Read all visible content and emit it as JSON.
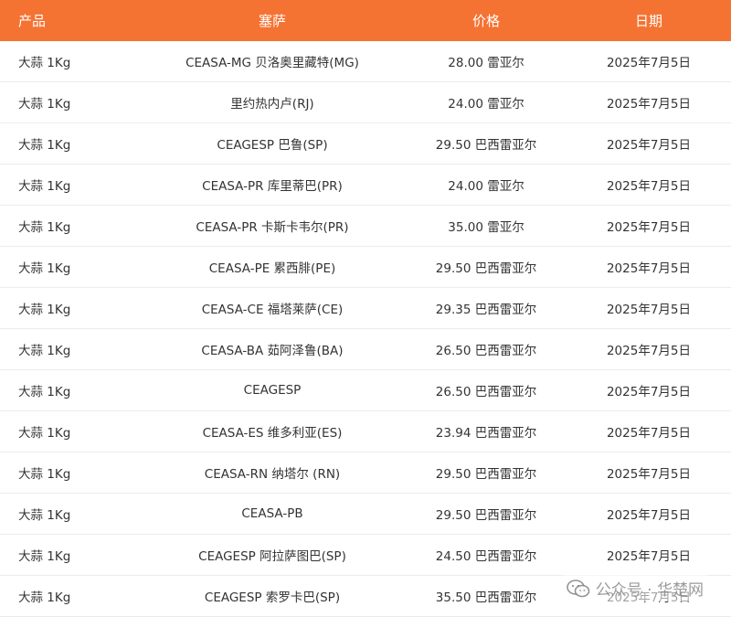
{
  "table": {
    "headers": [
      "产品",
      "塞萨",
      "价格",
      "日期"
    ],
    "rows": [
      [
        "大蒜 1Kg",
        "CEASA-MG 贝洛奥里藏特(MG)",
        "28.00 雷亚尔",
        "2025年7月5日"
      ],
      [
        "大蒜 1Kg",
        "里约热内卢(RJ)",
        "24.00 雷亚尔",
        "2025年7月5日"
      ],
      [
        "大蒜 1Kg",
        "CEAGESP 巴鲁(SP)",
        "29.50 巴西雷亚尔",
        "2025年7月5日"
      ],
      [
        "大蒜 1Kg",
        "CEASA-PR 库里蒂巴(PR)",
        "24.00 雷亚尔",
        "2025年7月5日"
      ],
      [
        "大蒜 1Kg",
        "CEASA-PR 卡斯卡韦尔(PR)",
        "35.00 雷亚尔",
        "2025年7月5日"
      ],
      [
        "大蒜 1Kg",
        "CEASA-PE 累西腓(PE)",
        "29.50 巴西雷亚尔",
        "2025年7月5日"
      ],
      [
        "大蒜 1Kg",
        "CEASA-CE 福塔莱萨(CE)",
        "29.35 巴西雷亚尔",
        "2025年7月5日"
      ],
      [
        "大蒜 1Kg",
        "CEASA-BA 茹阿泽鲁(BA)",
        "26.50 巴西雷亚尔",
        "2025年7月5日"
      ],
      [
        "大蒜 1Kg",
        "CEAGESP",
        "26.50 巴西雷亚尔",
        "2025年7月5日"
      ],
      [
        "大蒜 1Kg",
        "CEASA-ES 维多利亚(ES)",
        "23.94 巴西雷亚尔",
        "2025年7月5日"
      ],
      [
        "大蒜 1Kg",
        "CEASA-RN 纳塔尔 (RN)",
        "29.50 巴西雷亚尔",
        "2025年7月5日"
      ],
      [
        "大蒜 1Kg",
        "CEASA-PB",
        "29.50 巴西雷亚尔",
        "2025年7月5日"
      ],
      [
        "大蒜 1Kg",
        "CEAGESP 阿拉萨图巴(SP)",
        "24.50 巴西雷亚尔",
        "2025年7月5日"
      ],
      [
        "大蒜 1Kg",
        "CEAGESP 索罗卡巴(SP)",
        "35.50 巴西雷亚尔",
        "2025年7月5日"
      ]
    ]
  },
  "watermark": {
    "text": "公众号 · 华楚网",
    "icon": "wechat-icon"
  },
  "colors": {
    "header_bg": "#f57332",
    "header_text": "#ffffff",
    "row_border": "#ececec",
    "text": "#333333"
  }
}
